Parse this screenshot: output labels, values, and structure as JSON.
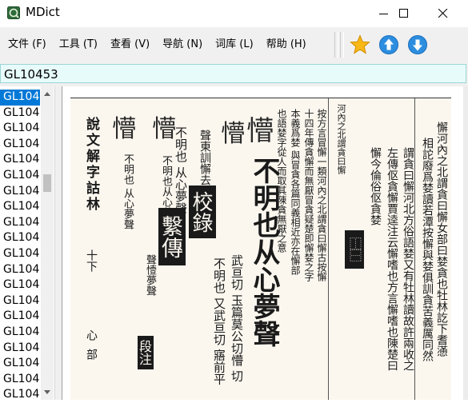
{
  "window": {
    "title": "MDict"
  },
  "menu": [
    {
      "label": "文件 (F)",
      "name": "menu-file"
    },
    {
      "label": "工具 (T)",
      "name": "menu-tools"
    },
    {
      "label": "查看 (V)",
      "name": "menu-view"
    },
    {
      "label": "导航 (N)",
      "name": "menu-navigate"
    },
    {
      "label": "词库 (L)",
      "name": "menu-library"
    },
    {
      "label": "帮助 (H)",
      "name": "menu-help"
    }
  ],
  "toolbar": {
    "favorite_icon": "star-icon",
    "back_icon": "arrow-up-icon",
    "forward_icon": "arrow-down-icon"
  },
  "search": {
    "value": "GL10453"
  },
  "word_list": [
    "GL104",
    "GL104",
    "GL104",
    "GL104",
    "GL104",
    "GL104",
    "GL104",
    "GL104",
    "GL104",
    "GL104",
    "GL104",
    "GL104",
    "GL104",
    "GL104",
    "GL104",
    "GL104",
    "GL104",
    "GL104",
    "GL104",
    "GL104"
  ],
  "selected_index": 0,
  "scan": {
    "columns": [
      "懈河內之北謂貪曰懈女部曰婪貪也牡林訖下耆懣",
      "相詑廢爲婪讀若潭按懈與婪俱訓貪苦義厲同然",
      "謂貪曰懈河北方俗語婪又有牡林讀故許兩收之",
      "左傳伛貪懈賈逵注云懈嗜也方言懈嗜也陳楚曰",
      "懈今倫俗伛貪婪",
      "河內之北謂貪曰懈",
      "按方言冒懈一類河內之北謂貪曰懈古按懈",
      "十四年傳貪懈而無厭冒貪疑楚即懈婪之字",
      "本義爲婪 與冒貪各篇同義相近亦在懈部",
      "也語婪字從人而取其陳貪無厭之意",
      "不明也从心夢聲",
      "武亘切 玉篇莫公切懵 切",
      "不明也 又武亘切 寤前平",
      "聲東訓懈去",
      "不明也 从心夢聲",
      "不明也从心夢聲",
      "聲㦉夢聲",
      "不明也 从心夢聲",
      "說文解字詁林",
      "十下",
      "心部"
    ],
    "seal_glyphs": [
      "懈",
      "懵",
      "懵",
      "懵",
      "懵"
    ],
    "stamps": [
      "校錄",
      "繫傳",
      "段注"
    ],
    "heading_label": "不明也从心夢聲",
    "fanqie": "武亘切"
  }
}
